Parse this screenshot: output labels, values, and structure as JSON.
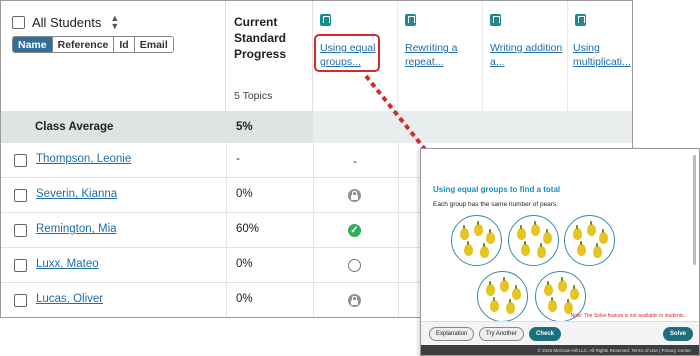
{
  "table": {
    "select_all_label": "All Students",
    "sort_icon": "sort-up-down-icon",
    "segments": [
      "Name",
      "Reference",
      "Id",
      "Email"
    ],
    "active_segment": "Name",
    "progress_header": "Current Standard Progress",
    "topics_count": "5 Topics",
    "topics": [
      {
        "label": "Using equal groups...",
        "icon": "bookmark-icon"
      },
      {
        "label": "Rewriting a repeat...",
        "icon": "bookmark-icon"
      },
      {
        "label": "Writing addition a...",
        "icon": "bookmark-icon"
      },
      {
        "label": "Using multiplicati...",
        "icon": "bookmark-icon"
      }
    ],
    "class_average": {
      "label": "Class Average",
      "value": "5%"
    },
    "students": [
      {
        "name": "Thompson, Leonie",
        "progress": "-",
        "status": "dash",
        "status_text": "-"
      },
      {
        "name": "Severin, Kianna",
        "progress": "0%",
        "status": "locked"
      },
      {
        "name": "Remington, Mia",
        "progress": "60%",
        "status": "completed"
      },
      {
        "name": "Luxx, Mateo",
        "progress": "0%",
        "status": "not-started"
      },
      {
        "name": "Lucas, Oliver",
        "progress": "0%",
        "status": "locked"
      }
    ]
  },
  "preview": {
    "title": "Using equal groups to find a total",
    "prompt": "Each group has the same number of pears.",
    "note": "Note: The Solve feature is not available to students.",
    "buttons": {
      "explanation": "Explanation",
      "try_another": "Try Another",
      "check": "Check",
      "solve": "Solve"
    },
    "footer": "© 2025 McGraw Hill LLC. All Rights Reserved.   Terms of Use   |   Privacy Center"
  },
  "colors": {
    "accent": "#1e6ea8",
    "highlight": "#d42a2a",
    "teal": "#1f8a8c",
    "success": "#2fae5b"
  }
}
